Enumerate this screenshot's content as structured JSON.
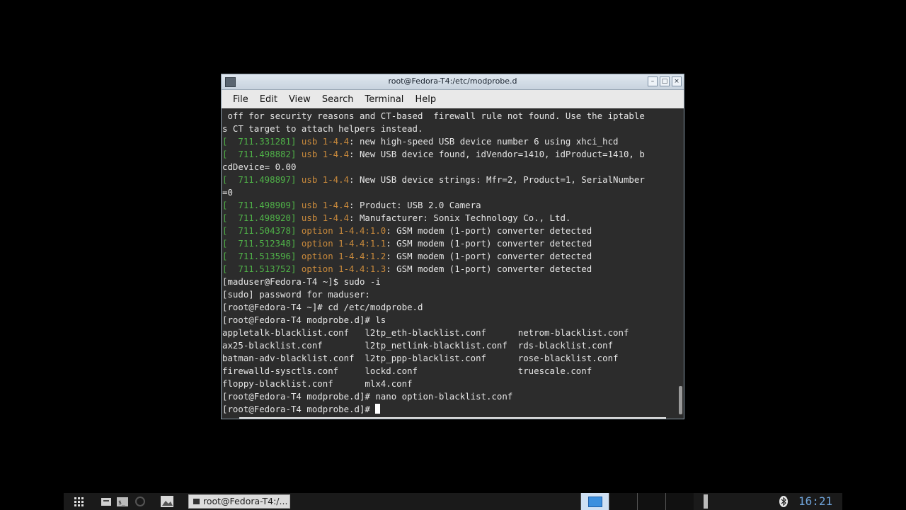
{
  "window": {
    "title": "root@Fedora-T4:/etc/modprobe.d",
    "buttons": {
      "minimize": "–",
      "maximize": "□",
      "close": "×"
    }
  },
  "menu": [
    "File",
    "Edit",
    "View",
    "Search",
    "Terminal",
    "Help"
  ],
  "terminal": {
    "lines": [
      {
        "segs": [
          {
            "t": " off for security reasons and CT-based  firewall rule not found. Use the iptable"
          }
        ]
      },
      {
        "segs": [
          {
            "t": "s CT target to attach helpers instead."
          }
        ]
      },
      {
        "segs": [
          {
            "t": "[  711.331281] ",
            "c": "g"
          },
          {
            "t": "usb 1-4.4",
            "c": "o"
          },
          {
            "t": ": new high-speed USB device number 6 using xhci_hcd"
          }
        ]
      },
      {
        "segs": [
          {
            "t": "[  711.498882] ",
            "c": "g"
          },
          {
            "t": "usb 1-4.4",
            "c": "o"
          },
          {
            "t": ": New USB device found, idVendor=1410, idProduct=1410, b"
          }
        ]
      },
      {
        "segs": [
          {
            "t": "cdDevice= 0.00"
          }
        ]
      },
      {
        "segs": [
          {
            "t": "[  711.498897] ",
            "c": "g"
          },
          {
            "t": "usb 1-4.4",
            "c": "o"
          },
          {
            "t": ": New USB device strings: Mfr=2, Product=1, SerialNumber"
          }
        ]
      },
      {
        "segs": [
          {
            "t": "=0"
          }
        ]
      },
      {
        "segs": [
          {
            "t": "[  711.498909] ",
            "c": "g"
          },
          {
            "t": "usb 1-4.4",
            "c": "o"
          },
          {
            "t": ": Product: USB 2.0 Camera"
          }
        ]
      },
      {
        "segs": [
          {
            "t": "[  711.498920] ",
            "c": "g"
          },
          {
            "t": "usb 1-4.4",
            "c": "o"
          },
          {
            "t": ": Manufacturer: Sonix Technology Co., Ltd."
          }
        ]
      },
      {
        "segs": [
          {
            "t": "[  711.504378] ",
            "c": "g"
          },
          {
            "t": "option 1-4.4:1.0",
            "c": "o"
          },
          {
            "t": ": GSM modem (1-port) converter detected"
          }
        ]
      },
      {
        "segs": [
          {
            "t": "[  711.512348] ",
            "c": "g"
          },
          {
            "t": "option 1-4.4:1.1",
            "c": "o"
          },
          {
            "t": ": GSM modem (1-port) converter detected"
          }
        ]
      },
      {
        "segs": [
          {
            "t": "[  711.513596] ",
            "c": "g"
          },
          {
            "t": "option 1-4.4:1.2",
            "c": "o"
          },
          {
            "t": ": GSM modem (1-port) converter detected"
          }
        ]
      },
      {
        "segs": [
          {
            "t": "[  711.513752] ",
            "c": "g"
          },
          {
            "t": "option 1-4.4:1.3",
            "c": "o"
          },
          {
            "t": ": GSM modem (1-port) converter detected"
          }
        ]
      },
      {
        "segs": [
          {
            "t": "[maduser@Fedora-T4 ~]$ sudo -i"
          }
        ]
      },
      {
        "segs": [
          {
            "t": "[sudo] password for maduser:"
          }
        ]
      },
      {
        "segs": [
          {
            "t": "[root@Fedora-T4 ~]# cd /etc/modprobe.d"
          }
        ]
      },
      {
        "segs": [
          {
            "t": "[root@Fedora-T4 modprobe.d]# ls"
          }
        ]
      },
      {
        "segs": [
          {
            "t": "appletalk-blacklist.conf   l2tp_eth-blacklist.conf      netrom-blacklist.conf"
          }
        ]
      },
      {
        "segs": [
          {
            "t": "ax25-blacklist.conf        l2tp_netlink-blacklist.conf  rds-blacklist.conf"
          }
        ]
      },
      {
        "segs": [
          {
            "t": "batman-adv-blacklist.conf  l2tp_ppp-blacklist.conf      rose-blacklist.conf"
          }
        ]
      },
      {
        "segs": [
          {
            "t": "firewalld-sysctls.conf     lockd.conf                   truescale.conf"
          }
        ]
      },
      {
        "segs": [
          {
            "t": "floppy-blacklist.conf      mlx4.conf"
          }
        ]
      },
      {
        "segs": [
          {
            "t": "[root@Fedora-T4 modprobe.d]# nano option-blacklist.conf"
          }
        ]
      },
      {
        "segs": [
          {
            "t": "[root@Fedora-T4 modprobe.d]# "
          }
        ],
        "cursor": true
      }
    ]
  },
  "taskbar": {
    "task_label": "root@Fedora-T4:/...",
    "clock": "16:21"
  },
  "colors": {
    "green": "#4fb248",
    "orange": "#c98a3c",
    "clock": "#6fa3d8"
  }
}
